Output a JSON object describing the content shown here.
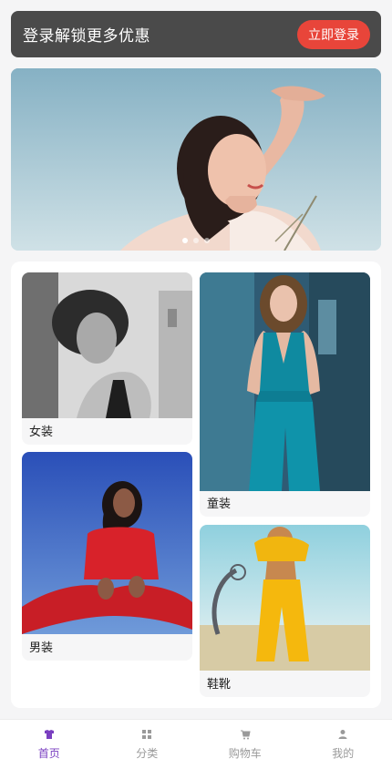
{
  "login_banner": {
    "text": "登录解锁更多优惠",
    "button_label": "立即登录"
  },
  "carousel": {
    "slide_count": 3,
    "active_index": 0
  },
  "categories": [
    {
      "label": "女装"
    },
    {
      "label": "童装"
    },
    {
      "label": "男装"
    },
    {
      "label": "鞋靴"
    }
  ],
  "bottom_nav": {
    "items": [
      {
        "label": "首页",
        "icon": "shirt-icon",
        "active": true
      },
      {
        "label": "分类",
        "icon": "grid-icon",
        "active": false
      },
      {
        "label": "购物车",
        "icon": "cart-icon",
        "active": false
      },
      {
        "label": "我的",
        "icon": "person-icon",
        "active": false
      }
    ]
  },
  "colors": {
    "accent": "#7a3fc0",
    "login_button": "#e8453a",
    "banner_bg": "#4a4a4a"
  }
}
